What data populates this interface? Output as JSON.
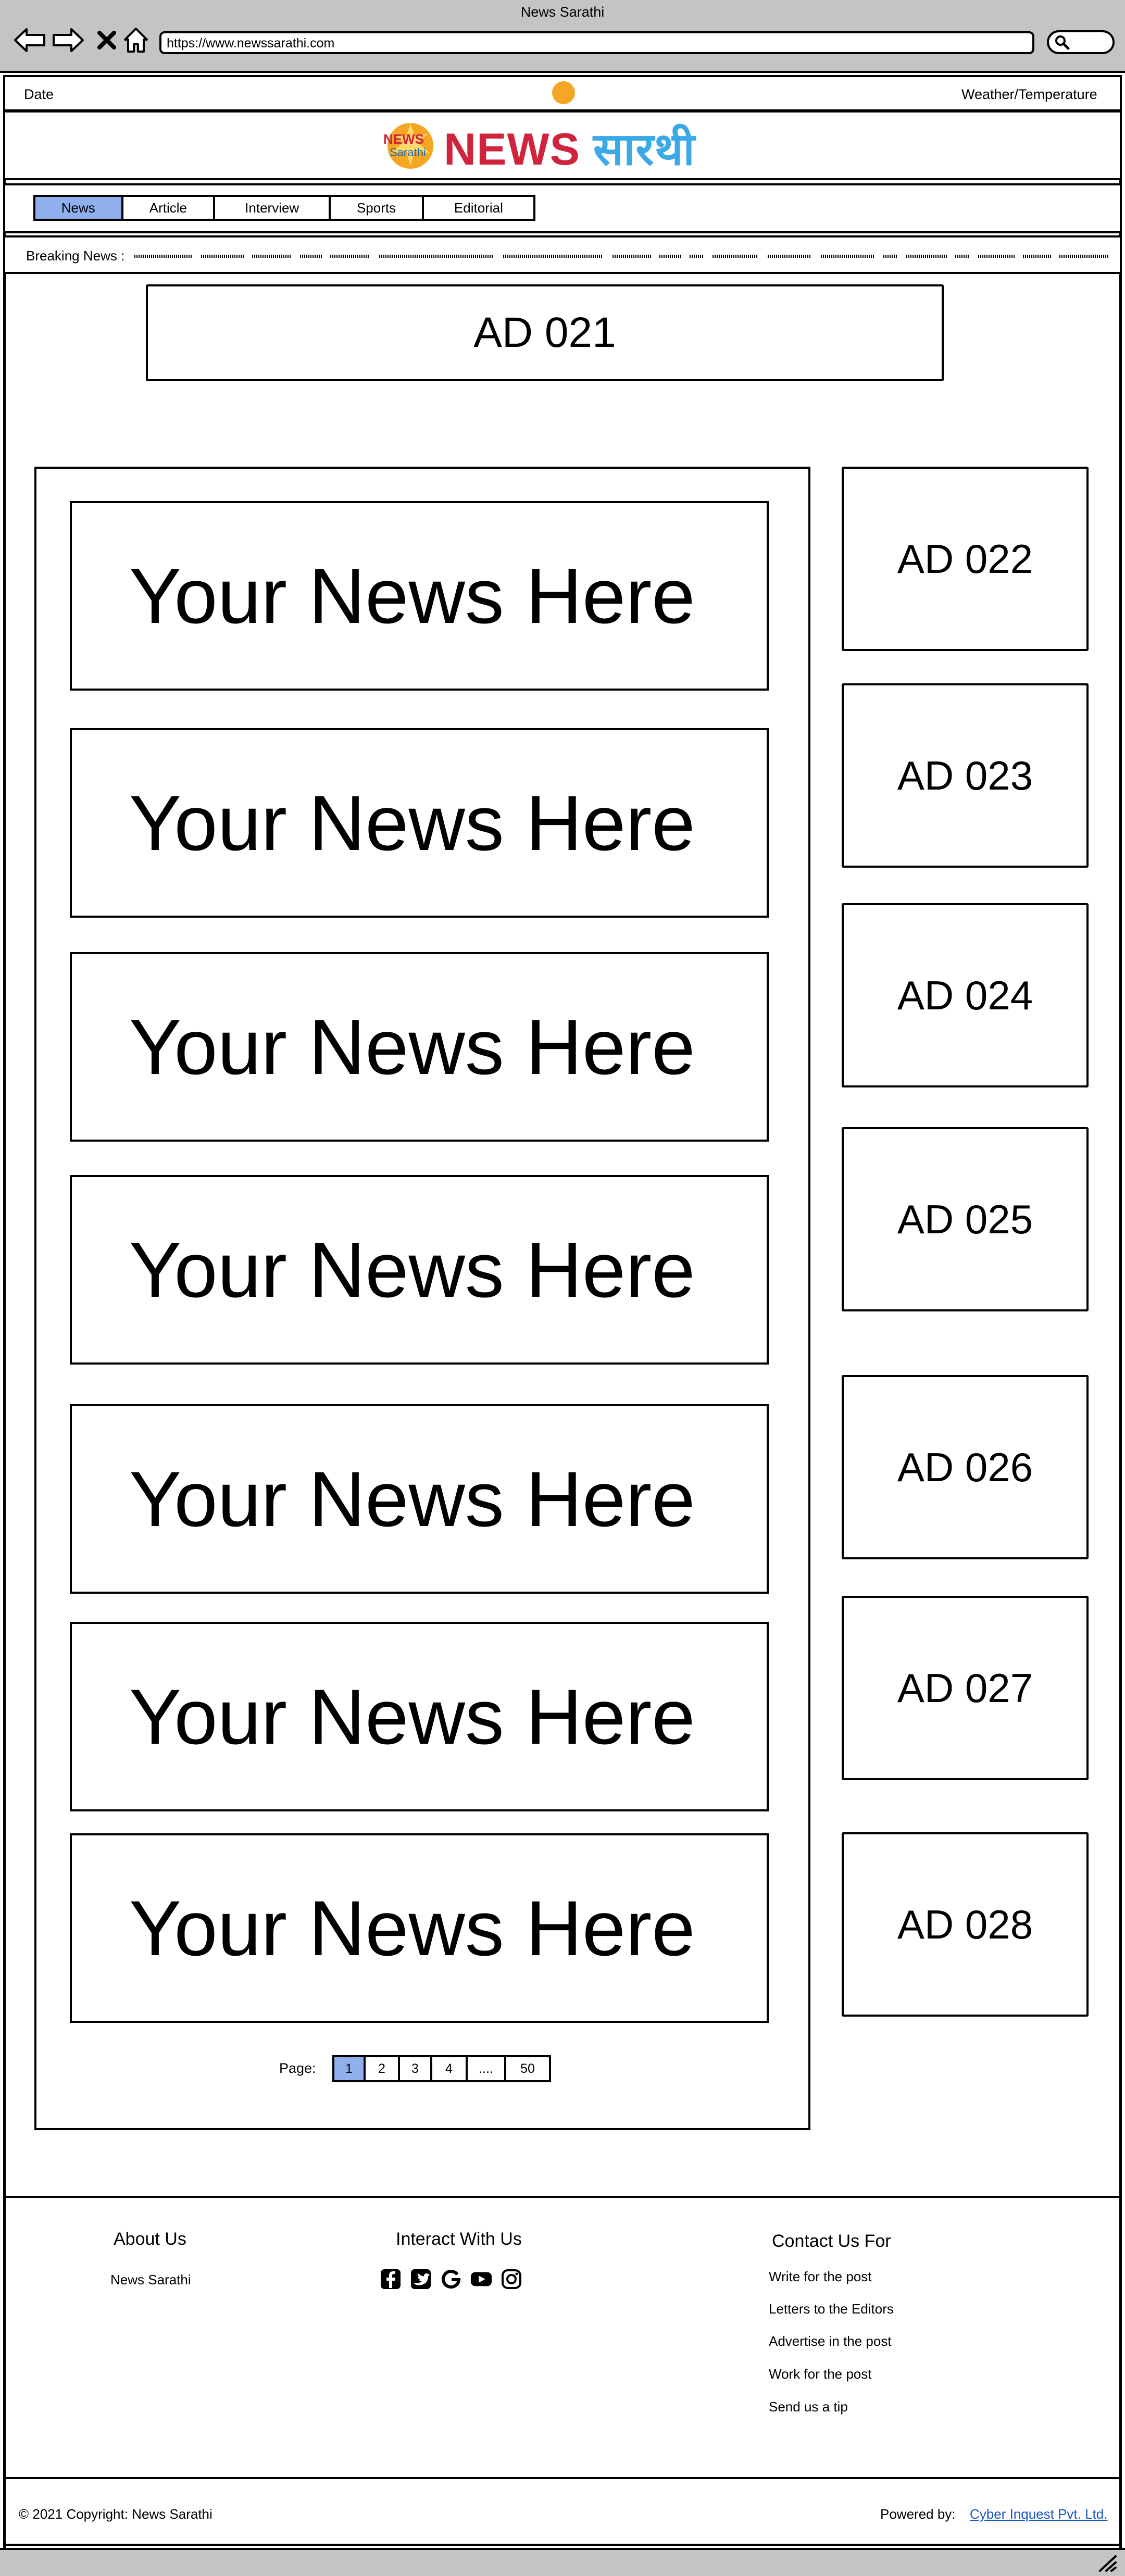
{
  "browser": {
    "window_title": "News Sarathi",
    "url": "https://www.newssarathi.com",
    "icons": [
      "back-arrow-icon",
      "forward-arrow-icon",
      "close-icon",
      "home-icon",
      "search-icon"
    ]
  },
  "topbar": {
    "date_label": "Date",
    "weather_label": "Weather/Temperature"
  },
  "brand": {
    "logo_text_top": "NEWS",
    "logo_text_bottom": "Sarathi",
    "title_latin": "NEWS",
    "title_devanagari": "सारथी",
    "colors": {
      "news_red": "#d0243c",
      "sarathi_blue": "#3aa9e6",
      "logo_orange": "#f5a623"
    }
  },
  "tabs": [
    {
      "label": "News",
      "active": true
    },
    {
      "label": "Article",
      "active": false
    },
    {
      "label": "Interview",
      "active": false
    },
    {
      "label": "Sports",
      "active": false
    },
    {
      "label": "Editorial",
      "active": false
    }
  ],
  "breaking": {
    "label": "Breaking News :"
  },
  "ads": {
    "top": "AD 021",
    "side": [
      "AD 022",
      "AD 023",
      "AD 024",
      "AD 025",
      "AD 026",
      "AD 027",
      "AD 028"
    ]
  },
  "news": {
    "cards": [
      "Your News Here",
      "Your News Here",
      "Your News Here",
      "Your News Here",
      "Your News Here",
      "Your News Here",
      "Your News Here"
    ]
  },
  "pagination": {
    "label": "Page:",
    "pages": [
      "1",
      "2",
      "3",
      "4",
      "....",
      "50"
    ],
    "active": "1"
  },
  "footer": {
    "about": {
      "heading": "About Us",
      "text": "News Sarathi"
    },
    "interact": {
      "heading": "Interact With Us",
      "icons": [
        "facebook-icon",
        "twitter-icon",
        "google-icon",
        "youtube-icon",
        "instagram-icon"
      ]
    },
    "contact": {
      "heading": "Contact Us For",
      "items": [
        "Write for the post",
        "Letters to the Editors",
        "Advertise in the post",
        "Work for the post",
        "Send us a tip"
      ]
    },
    "copyright": "© 2021 Copyright: News Sarathi",
    "powered_label": "Powered by:",
    "powered_link": "Cyber Inquest Pvt. Ltd."
  },
  "colors": {
    "chrome_gray": "#c4c4c4",
    "active_tab_blue": "#8fb0ed",
    "link_blue": "#1a56c6"
  }
}
